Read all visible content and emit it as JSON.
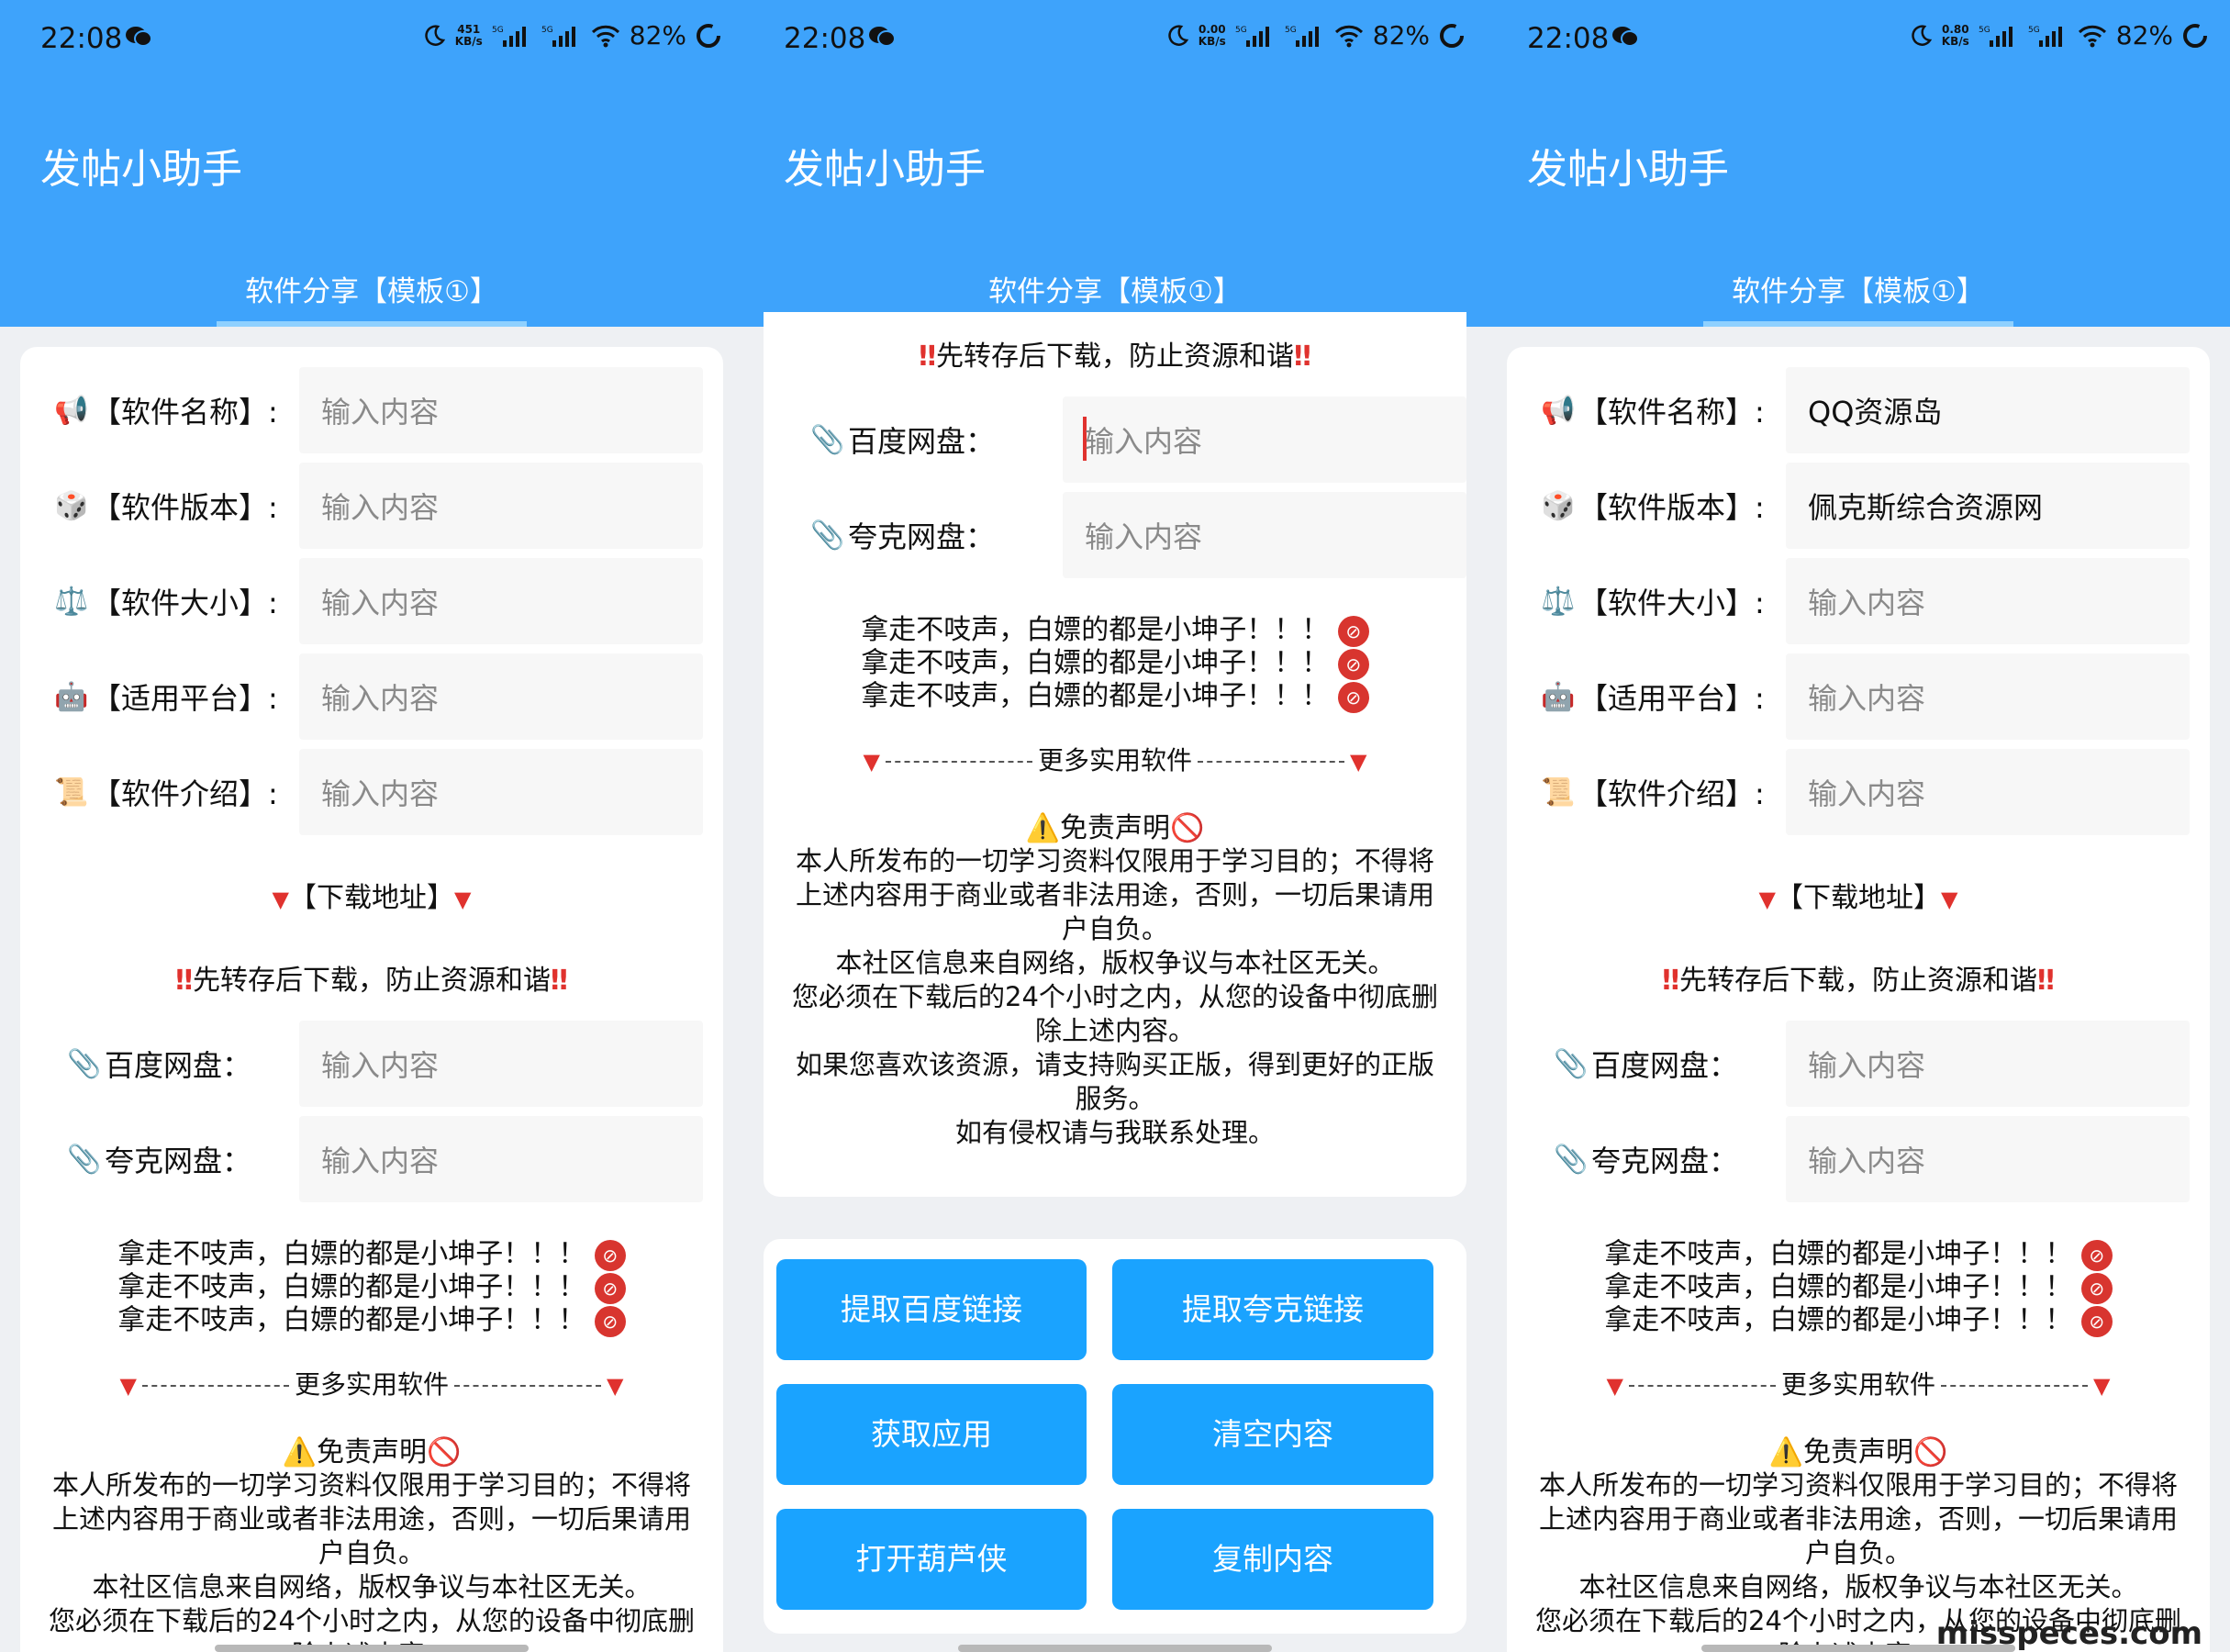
{
  "status": {
    "time": "22:08",
    "battery": "82%",
    "speeds": [
      "451",
      "0.00",
      "0.80"
    ],
    "speed_unit": "KB/s",
    "net": "5G"
  },
  "app": {
    "title": "发帖小助手",
    "tab": "软件分享【模板①】"
  },
  "fields": [
    {
      "icon": "📢",
      "label": "【软件名称】:"
    },
    {
      "icon": "🎲",
      "label": "【软件版本】:"
    },
    {
      "icon": "⚖️",
      "label": "【软件大小】:"
    },
    {
      "icon": "🤖",
      "label": "【适用平台】:"
    },
    {
      "icon": "📜",
      "label": "【软件介绍】:"
    }
  ],
  "placeholder": "输入内容",
  "filled": {
    "name": "QQ资源岛",
    "version": "佩克斯综合资源网"
  },
  "download_title": "【下载地址】",
  "save_notice": "先转存后下载，防止资源和谐",
  "links": [
    {
      "icon": "📎",
      "label": "百度网盘："
    },
    {
      "icon": "📎",
      "label": "夸克网盘："
    }
  ],
  "tease": "拿走不吱声，白嫖的都是小坤子！！！",
  "more": "更多实用软件",
  "disclaimer_title": "免责声明",
  "disclaimer": [
    "本人所发布的一切学习资料仅限用于学习目的；不得将上述内容用于商业或者非法用途，否则，一切后果请用户自负。",
    "本社区信息来自网络，版权争议与本社区无关。",
    "您必须在下载后的24个小时之内，从您的设备中彻底删除上述内容。",
    "如果您喜欢该资源，请支持购买正版，得到更好的正版服务。",
    "如有侵权请与我联系处理。"
  ],
  "buttons": {
    "extract_baidu": "提取百度链接",
    "extract_quark": "提取夸克链接",
    "get_app": "获取应用",
    "clear": "清空内容",
    "open_hlx": "打开葫芦侠",
    "copy": "复制内容"
  },
  "watermark": "misspeces.com"
}
